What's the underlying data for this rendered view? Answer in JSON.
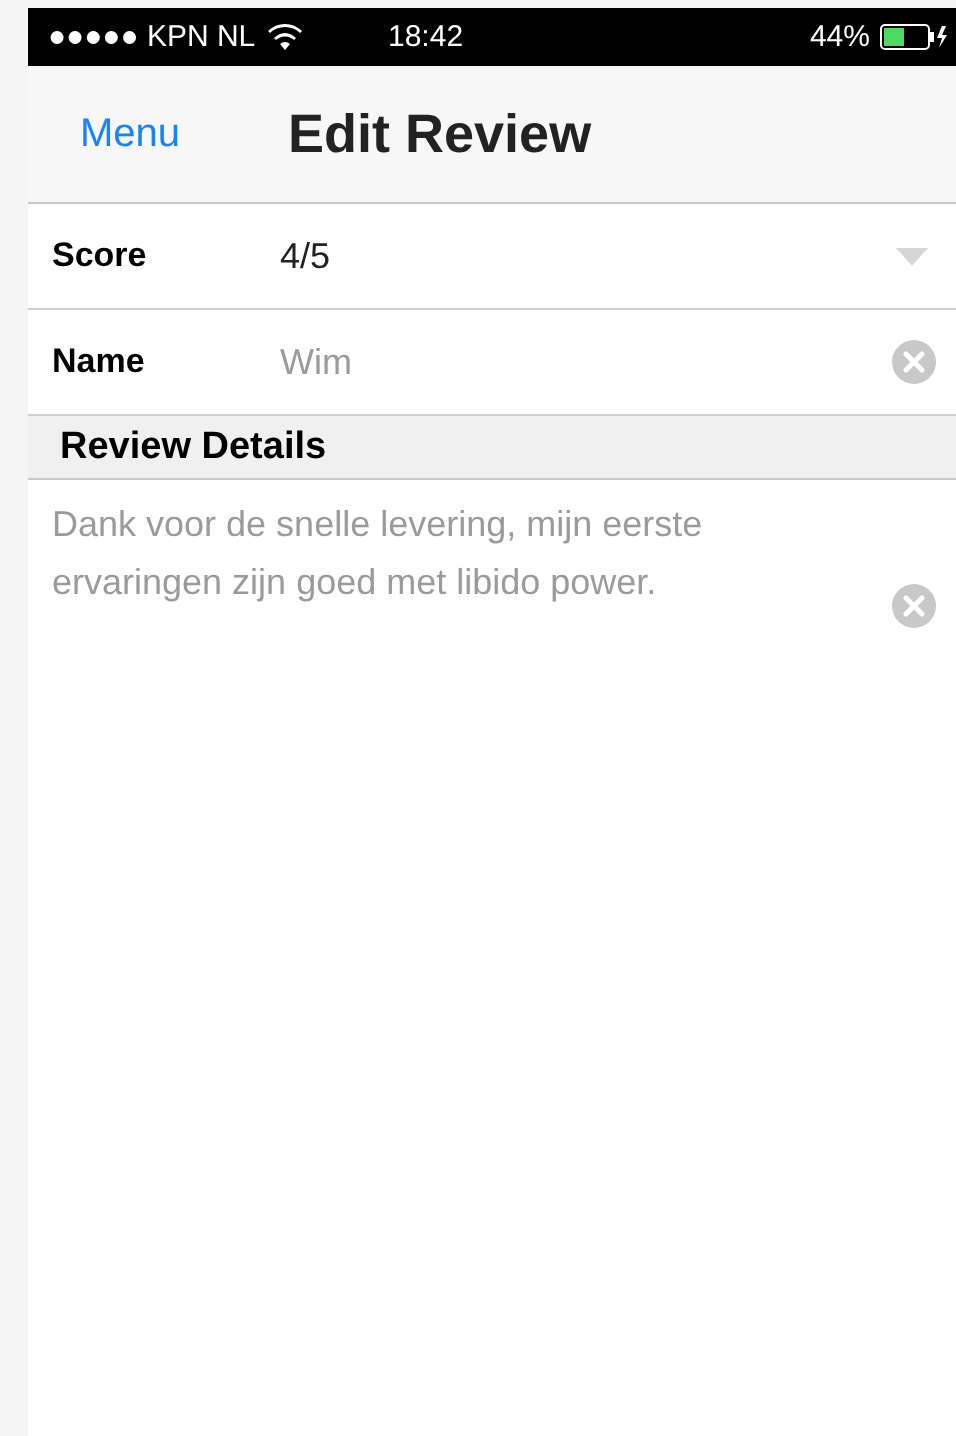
{
  "status_bar": {
    "carrier": "●●●●● KPN NL",
    "time": "18:42",
    "battery": "44%"
  },
  "nav_bar": {
    "back": "Menu",
    "title": "Edit Review"
  },
  "fields": [
    {
      "kind": "dropdown",
      "label": "Score",
      "value": "4/5"
    },
    {
      "kind": "text",
      "label": "Name",
      "value": "Wim"
    }
  ],
  "section": {
    "title": "Review Details"
  },
  "details": {
    "value": "Dank voor de snelle levering, mijn eerste ervaringen zijn goed met libido power."
  }
}
